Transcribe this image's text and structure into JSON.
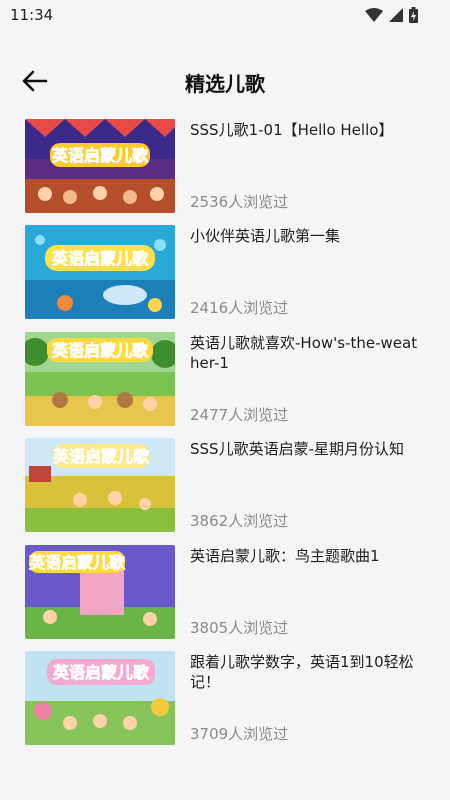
{
  "status_bar": {
    "time": "11:34"
  },
  "header": {
    "title": "精选儿歌"
  },
  "songs": [
    {
      "title": "SSS儿歌1-01【Hello Hello】",
      "views": "2536人浏览过",
      "banner": "英语启蒙儿歌"
    },
    {
      "title": "小伙伴英语儿歌第一集",
      "views": "2416人浏览过",
      "banner": "英语启蒙儿歌"
    },
    {
      "title": "英语儿歌就喜欢-How's-the-weather-1",
      "views": "2477人浏览过",
      "banner": "英语启蒙儿歌"
    },
    {
      "title": "SSS儿歌英语启蒙-星期月份认知",
      "views": "3862人浏览过",
      "banner": "英语启蒙儿歌"
    },
    {
      "title": "英语启蒙儿歌：鸟主题歌曲1",
      "views": "3805人浏览过",
      "banner": "英语启蒙儿歌"
    },
    {
      "title": "跟着儿歌学数字，英语1到10轻松记！",
      "views": "3709人浏览过",
      "banner": "英语启蒙儿歌"
    }
  ]
}
